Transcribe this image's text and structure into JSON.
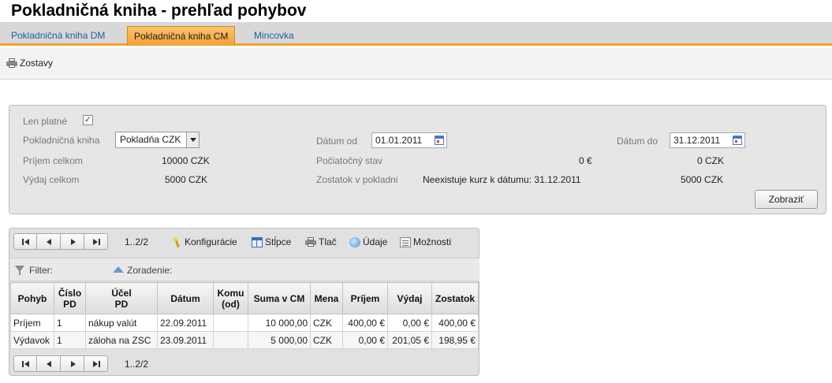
{
  "page": {
    "title": "Pokladničná kniha - prehľad pohybov"
  },
  "tabs": [
    {
      "label": "Pokladničná kniha DM",
      "active": false
    },
    {
      "label": "Pokladničná kniha CM",
      "active": true
    },
    {
      "label": "Mincovka",
      "active": false
    }
  ],
  "toolbar": {
    "reports_label": "Zostavy",
    "reports_icon": "printer-icon"
  },
  "form": {
    "only_valid_label": "Len platné",
    "only_valid_checked": true,
    "only_valid_mark": "✓",
    "cashbook_label": "Pokladničná kniha",
    "cashbook_value": "Pokladňa CZK",
    "date_from_label": "Dátum od",
    "date_from_value": "01.01.2011",
    "date_to_label": "Dátum do",
    "date_to_value": "31.12.2011",
    "income_total_label": "Príjem celkom",
    "income_total_value": "10000 CZK",
    "opening_state_label": "Počiatočný stav",
    "opening_state_value_eur": "0 €",
    "opening_state_value_czk": "0 CZK",
    "expense_total_label": "Výdaj celkom",
    "expense_total_value": "5000 CZK",
    "balance_label": "Zostatok v pokladni",
    "balance_note": "Neexistuje kurz k dátumu: 31.12.2011",
    "balance_value_czk": "5000 CZK",
    "show_button": "Zobraziť"
  },
  "grid": {
    "pager_info": "1..2/2",
    "tools": {
      "config": "Konfigurácie",
      "columns": "Stĺpce",
      "print": "Tlač",
      "data": "Údaje",
      "options": "Možnosti"
    },
    "filter_label": "Filter:",
    "sort_label": "Zoradenie:",
    "columns": {
      "pohyb": "Pohyb",
      "cislo_a": "Číslo",
      "cislo_b": "PD",
      "ucel_a": "Účel",
      "ucel_b": "PD",
      "datum": "Dátum",
      "komu_a": "Komu",
      "komu_b": "(od)",
      "suma": "Suma v CM",
      "mena": "Mena",
      "prijem": "Príjem",
      "vydaj": "Výdaj",
      "zostatok": "Zostatok"
    },
    "rows": [
      {
        "pohyb": "Príjem",
        "cislo": "1",
        "ucel": "nákup valút",
        "datum": "22.09.2011",
        "komu": "",
        "suma": "10 000,00",
        "mena": "CZK",
        "prijem": "400,00 €",
        "vydaj": "0,00 €",
        "zostatok": "400,00 €"
      },
      {
        "pohyb": "Výdavok",
        "cislo": "1",
        "ucel": "záloha na ZSC",
        "datum": "23.09.2011",
        "komu": "",
        "suma": "5 000,00",
        "mena": "CZK",
        "prijem": "0,00 €",
        "vydaj": "201,05 €",
        "zostatok": "198,95 €"
      }
    ]
  }
}
